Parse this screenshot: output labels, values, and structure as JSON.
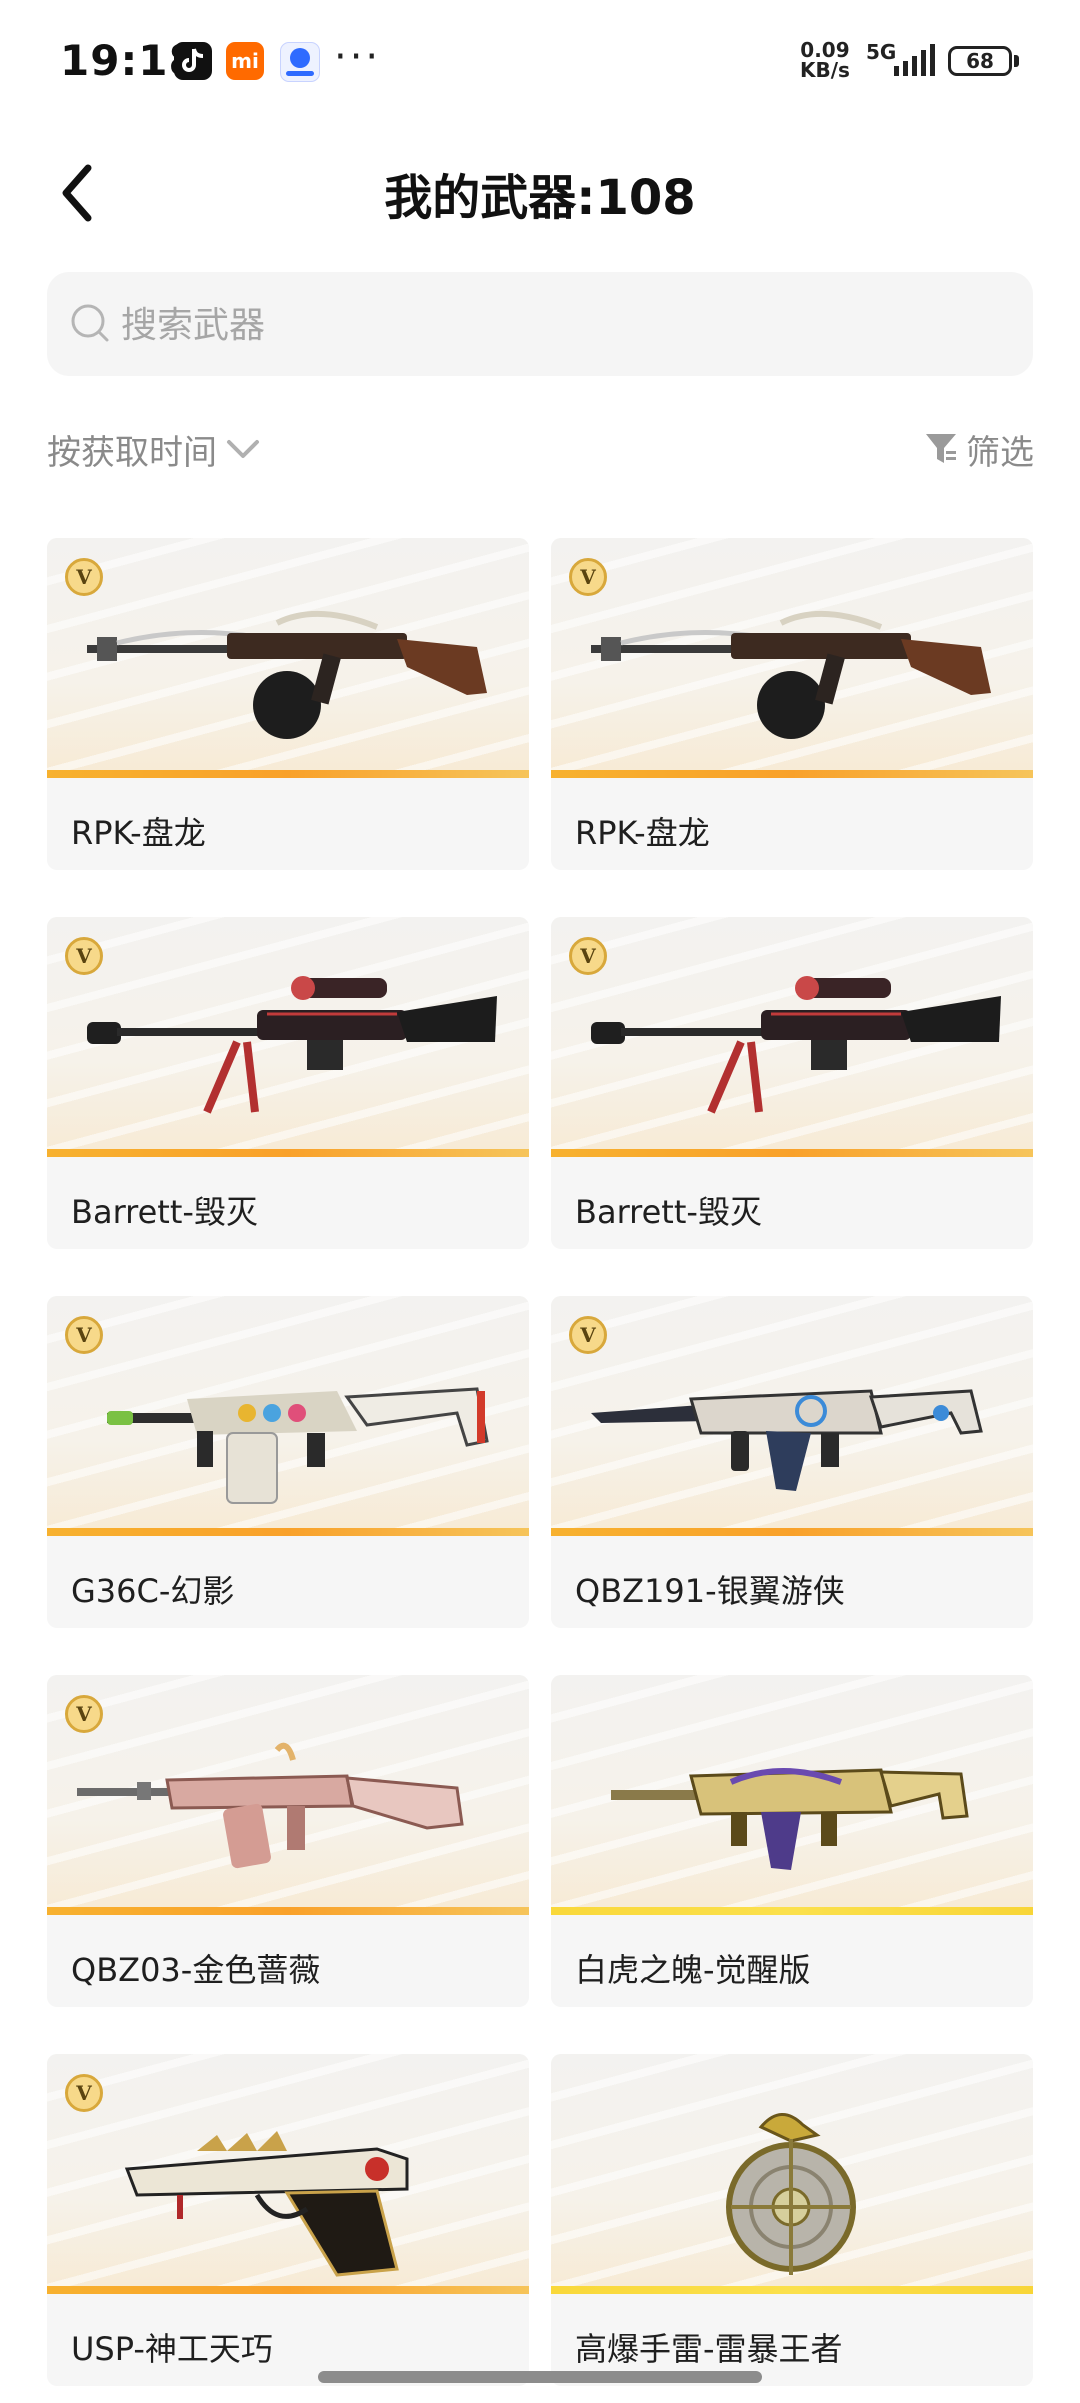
{
  "status_bar": {
    "time": "19:18",
    "net_speed_value": "0.09",
    "net_speed_unit": "KB/s",
    "network": "5G",
    "battery": "68",
    "more_dots": "···",
    "mi_icon_text": "mi"
  },
  "header": {
    "title": "我的武器:108",
    "back_icon": "chevron-left-icon"
  },
  "search": {
    "placeholder": "搜索武器",
    "value": ""
  },
  "toolbar": {
    "sort_label": "按获取时间",
    "filter_label": "筛选"
  },
  "weapons": [
    {
      "name": "RPK-盘龙",
      "badge": "V",
      "art": "rifle-drum"
    },
    {
      "name": "RPK-盘龙",
      "badge": "V",
      "art": "rifle-drum"
    },
    {
      "name": "Barrett-毁灭",
      "badge": "V",
      "art": "sniper"
    },
    {
      "name": "Barrett-毁灭",
      "badge": "V",
      "art": "sniper"
    },
    {
      "name": "G36C-幻影",
      "badge": "V",
      "art": "rifle-mag"
    },
    {
      "name": "QBZ191-银翼游侠",
      "badge": "V",
      "art": "rifle-sleek"
    },
    {
      "name": "QBZ03-金色蔷薇",
      "badge": "V",
      "art": "rifle-pink"
    },
    {
      "name": "白虎之魄-觉醒版",
      "badge": "",
      "art": "rifle-gold"
    },
    {
      "name": "USP-神工天巧",
      "badge": "V",
      "art": "pistol"
    },
    {
      "name": "高爆手雷-雷暴王者",
      "badge": "",
      "art": "grenade"
    }
  ],
  "colors": {
    "accent_strip": "#f7b12f",
    "badge_gold": "#d8a83b",
    "card_bg": "#f6f6f6",
    "muted_text": "#8a8a8a"
  }
}
